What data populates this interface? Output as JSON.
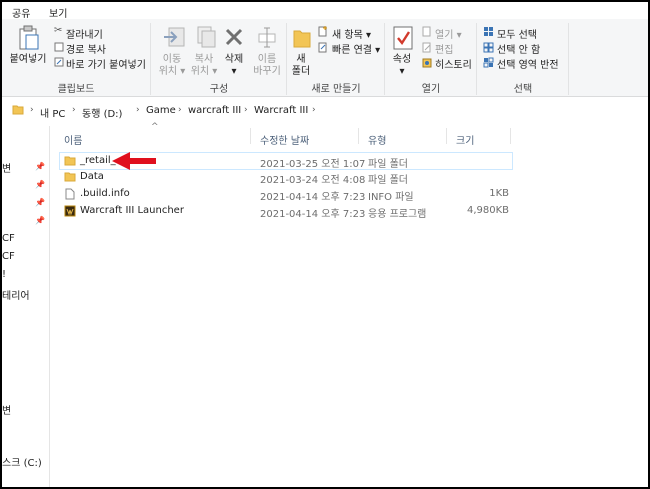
{
  "tabs": [
    "공유",
    "보기"
  ],
  "ribbon": {
    "clipboard": {
      "paste": "붙여넣기",
      "cut": "잘라내기",
      "copy_path": "경로 복사",
      "paste_shortcut": "바로 가기 붙여넣기",
      "label": "클립보드"
    },
    "organize": {
      "move_to_line1": "이동",
      "move_to_line2": "위치",
      "copy_to_line1": "복사",
      "copy_to_line2": "위치",
      "delete": "삭제",
      "rename_line1": "이름",
      "rename_line2": "바꾸기",
      "label": "구성"
    },
    "new": {
      "new_folder_line1": "새",
      "new_folder_line2": "폴더",
      "new_item": "새 항목",
      "easy_access": "빠른 연결",
      "label": "새로 만들기"
    },
    "open": {
      "properties": "속성",
      "open": "열기",
      "edit": "편집",
      "history": "히스토리",
      "label": "열기"
    },
    "select": {
      "select_all": "모두 선택",
      "select_none": "선택 안 함",
      "invert": "선택 영역 반전",
      "label": "선택"
    }
  },
  "address": {
    "crumbs": [
      "내 PC",
      "동행 (D:)",
      "Game",
      "warcraft III",
      "Warcraft III"
    ]
  },
  "nav": {
    "fragments": [
      "변",
      "CF",
      "CF",
      "!",
      "테리어",
      "변",
      "스크 (C:)"
    ]
  },
  "columns": {
    "name": "이름",
    "date": "수정한 날짜",
    "type": "유형",
    "size": "크기"
  },
  "files": [
    {
      "name": "_retail_",
      "date": "2021-03-25 오전 1:07",
      "type": "파일 폴더",
      "size": "",
      "icon": "folder-icon"
    },
    {
      "name": "Data",
      "date": "2021-03-24 오전 4:08",
      "type": "파일 폴더",
      "size": "",
      "icon": "folder-icon"
    },
    {
      "name": ".build.info",
      "date": "2021-04-14 오후 7:23",
      "type": "INFO 파일",
      "size": "1KB",
      "icon": "file-icon"
    },
    {
      "name": "Warcraft III Launcher",
      "date": "2021-04-14 오후 7:23",
      "type": "응용 프로그램",
      "size": "4,980KB",
      "icon": "app-icon"
    }
  ],
  "colors": {
    "folder": "#f2c555",
    "accent": "#cce8ff",
    "arrow": "#e0101e"
  }
}
